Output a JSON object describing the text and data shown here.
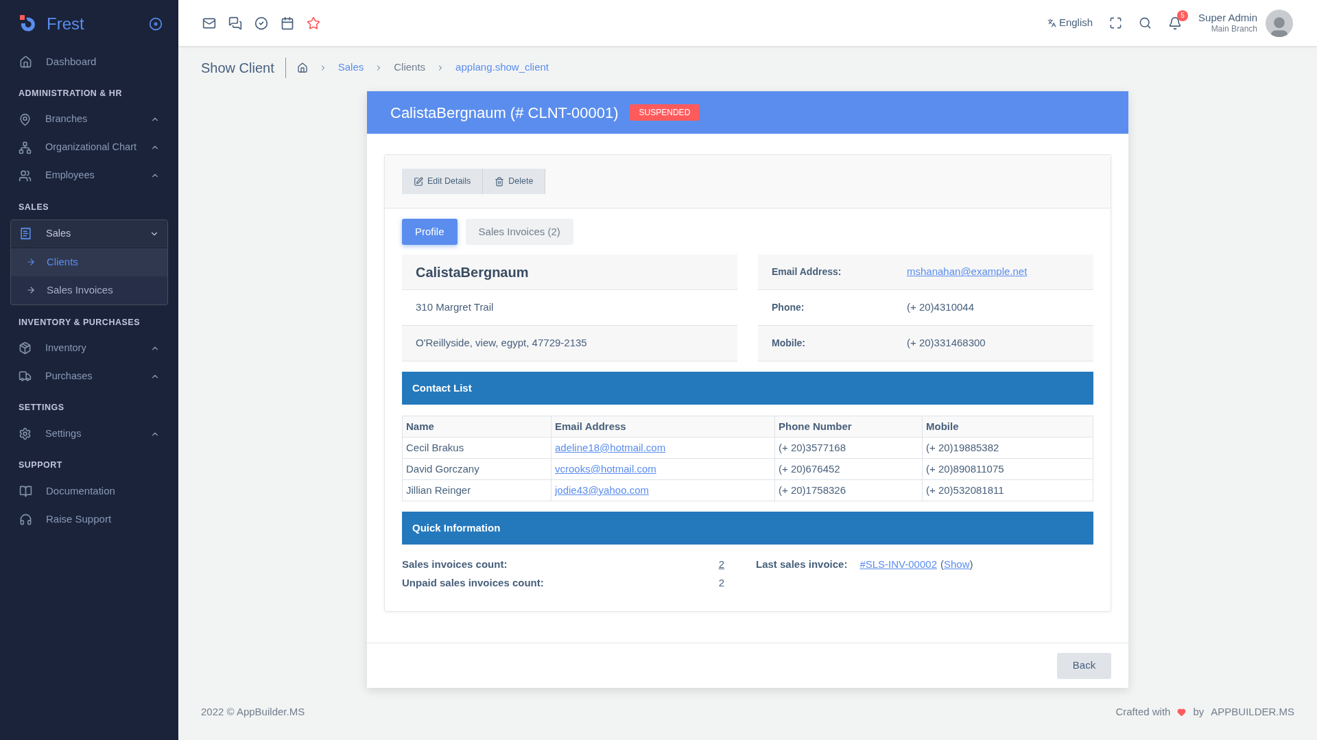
{
  "brand": "Frest",
  "sidebar": [
    {
      "kind": "link",
      "label": "Dashboard"
    },
    {
      "kind": "heading",
      "label": "ADMINISTRATION & HR"
    },
    {
      "kind": "group",
      "label": "Branches",
      "expanded": false
    },
    {
      "kind": "group",
      "label": "Organizational Chart",
      "expanded": false
    },
    {
      "kind": "group",
      "label": "Employees",
      "expanded": false
    },
    {
      "kind": "heading",
      "label": "SALES"
    },
    {
      "kind": "group",
      "label": "Sales",
      "expanded": true,
      "children": [
        {
          "label": "Clients",
          "selected": true
        },
        {
          "label": "Sales Invoices",
          "selected": false
        }
      ]
    },
    {
      "kind": "heading",
      "label": "INVENTORY & PURCHASES"
    },
    {
      "kind": "group",
      "label": "Inventory",
      "expanded": false
    },
    {
      "kind": "group",
      "label": "Purchases",
      "expanded": false
    },
    {
      "kind": "heading",
      "label": "SETTINGS"
    },
    {
      "kind": "group",
      "label": "Settings",
      "expanded": false
    },
    {
      "kind": "heading",
      "label": "SUPPORT"
    },
    {
      "kind": "link",
      "label": "Documentation"
    },
    {
      "kind": "link",
      "label": "Raise Support"
    }
  ],
  "topbar": {
    "language": "English",
    "notifications": "5",
    "user_name": "Super Admin",
    "user_branch": "Main Branch"
  },
  "page_title": "Show Client",
  "breadcrumb": [
    {
      "label": "Sales",
      "link": true
    },
    {
      "label": "Clients",
      "link": false
    },
    {
      "label": "applang.show_client",
      "link": true
    }
  ],
  "card": {
    "title": "CalistaBergnaum (# CLNT-00001)",
    "status": "SUSPENDED",
    "actions": [
      "Edit Details",
      "Delete"
    ],
    "tabs": [
      {
        "label": "Profile",
        "selected": true
      },
      {
        "label": "Sales Invoices (2)",
        "selected": false
      }
    ],
    "client_name": "CalistaBergnaum",
    "address_lines": [
      "310 Margret Trail",
      "O'Reillyside, view, egypt, 47729-2135"
    ],
    "details": [
      {
        "label": "Email Address:",
        "value": "mshanahan@example.net",
        "link": true
      },
      {
        "label": "Phone:",
        "value": "(+ 20)4310044",
        "link": false
      },
      {
        "label": "Mobile:",
        "value": "(+ 20)331468300",
        "link": false
      }
    ],
    "contact_title": "Contact List",
    "contact_columns": [
      "Name",
      "Email Address",
      "Phone Number",
      "Mobile"
    ],
    "contacts": [
      [
        "Cecil Brakus",
        "adeline18@hotmail.com",
        "(+ 20)3577168",
        "(+ 20)19885382"
      ],
      [
        "David Gorczany",
        "vcrooks@hotmail.com",
        "(+ 20)676452",
        "(+ 20)890811075"
      ],
      [
        "Jillian Reinger",
        "jodie43@yahoo.com",
        "(+ 20)1758326",
        "(+ 20)532081811"
      ]
    ],
    "quick_title": "Quick Information",
    "quick": {
      "count_label": "Sales invoices count:",
      "count": "2",
      "unpaid_label": "Unpaid sales invoices count:",
      "unpaid": "2",
      "last_label": "Last sales invoice:",
      "last_value": "#SLS-INV-00002",
      "show_open": "(",
      "show": "Show",
      "show_close": ")"
    },
    "back": "Back"
  },
  "footer": {
    "copyright": "2022 © AppBuilder.MS",
    "crafted": "Crafted with",
    "by": "by",
    "company": "APPBUILDER.MS"
  }
}
